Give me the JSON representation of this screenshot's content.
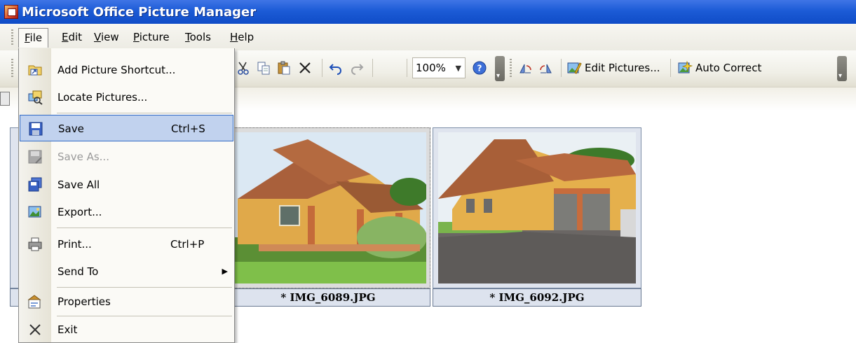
{
  "window": {
    "title": "Microsoft Office Picture Manager"
  },
  "menubar": {
    "items": [
      {
        "label": "File",
        "key": "F"
      },
      {
        "label": "Edit",
        "key": "E"
      },
      {
        "label": "View",
        "key": "V"
      },
      {
        "label": "Picture",
        "key": "P"
      },
      {
        "label": "Tools",
        "key": "T"
      },
      {
        "label": "Help",
        "key": "H"
      }
    ]
  },
  "toolbar": {
    "zoom_value": "100%",
    "edit_pictures_label": "Edit Pictures...",
    "auto_correct_label": "Auto Correct",
    "icons": [
      "cut-icon",
      "copy-icon",
      "paste-icon",
      "delete-icon",
      "undo-icon",
      "redo-icon",
      "help-icon",
      "rotate-left-icon",
      "rotate-right-icon",
      "edit-pictures-icon",
      "auto-correct-icon"
    ]
  },
  "file_menu": {
    "items": [
      {
        "label": "Add Picture Shortcut...",
        "icon": "add-shortcut-icon",
        "enabled": true
      },
      {
        "label": "Locate Pictures...",
        "icon": "locate-pictures-icon",
        "enabled": true
      },
      {
        "label": "Save",
        "shortcut": "Ctrl+S",
        "icon": "save-icon",
        "enabled": true,
        "highlighted": true
      },
      {
        "label": "Save As...",
        "icon": "save-as-icon",
        "enabled": false
      },
      {
        "label": "Save All",
        "icon": "save-all-icon",
        "enabled": true
      },
      {
        "label": "Export...",
        "icon": "export-icon",
        "enabled": true
      },
      {
        "label": "Print...",
        "shortcut": "Ctrl+P",
        "icon": "print-icon",
        "enabled": true
      },
      {
        "label": "Send To",
        "icon": "",
        "enabled": true,
        "submenu": true
      },
      {
        "label": "Properties",
        "icon": "properties-icon",
        "enabled": true
      },
      {
        "label": "Exit",
        "icon": "exit-icon",
        "enabled": true
      }
    ]
  },
  "thumbnails": [
    {
      "caption": "* IMG_6089.JPG",
      "selected": true
    },
    {
      "caption": "* IMG_6092.JPG",
      "selected": false
    }
  ]
}
